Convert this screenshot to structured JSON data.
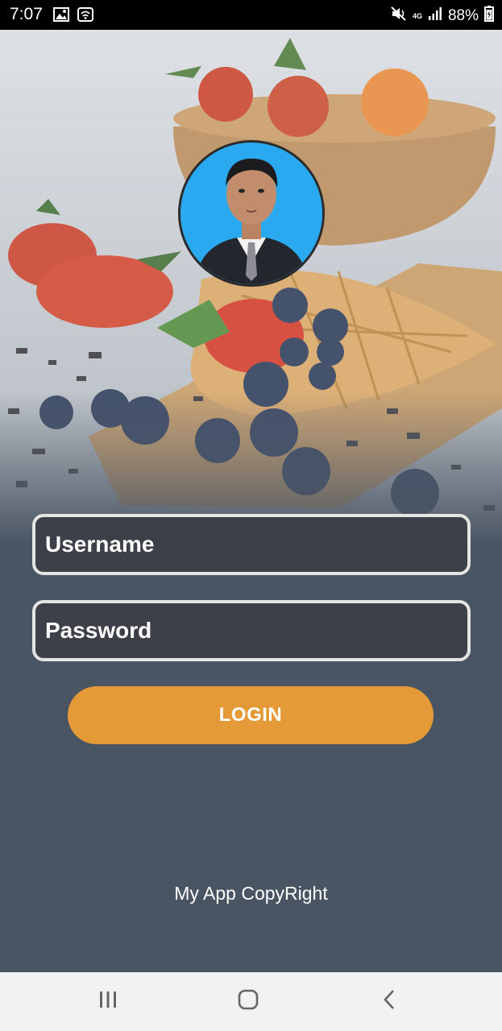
{
  "status_bar": {
    "time": "7:07",
    "network": "4G",
    "battery": "88%",
    "icons": [
      "gallery-icon",
      "wifi-icon",
      "mute-icon",
      "signal-icon",
      "battery-icon"
    ]
  },
  "login": {
    "username_placeholder": "Username",
    "password_placeholder": "Password",
    "login_label": "LOGIN"
  },
  "footer": {
    "copyright": "My App CopyRight"
  },
  "nav_bar": {
    "icons": [
      "recents-icon",
      "home-icon",
      "back-icon"
    ]
  },
  "colors": {
    "accent": "#e49b37",
    "field_border": "#e4e4e4",
    "background": "#4a5563",
    "avatar_bg": "#2aa9f0"
  }
}
